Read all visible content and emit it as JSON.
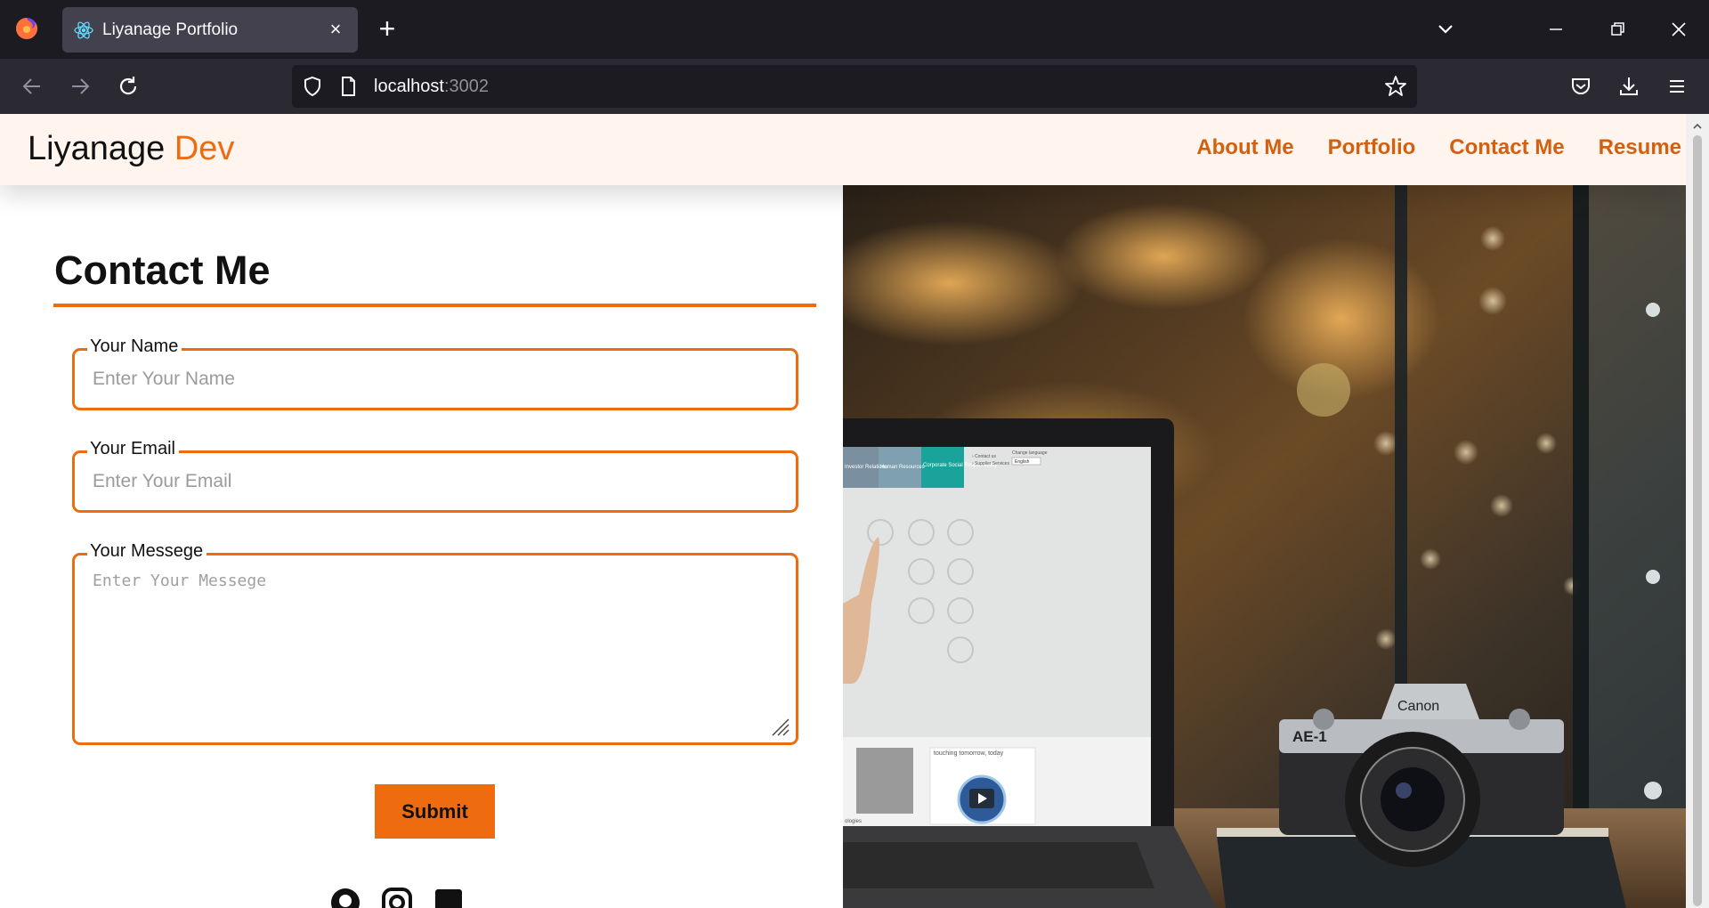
{
  "browser": {
    "tab_title": "Liyanage Portfolio",
    "url_host": "localhost",
    "url_port": ":3002"
  },
  "site": {
    "brand_main": "Liyanage",
    "brand_accent": "Dev",
    "nav": [
      "About Me",
      "Portfolio",
      "Contact Me",
      "Resume"
    ]
  },
  "contact": {
    "title": "Contact Me",
    "name_label": "Your Name",
    "name_placeholder": "Enter Your Name",
    "name_value": "",
    "email_label": "Your Email",
    "email_placeholder": "Enter Your Email",
    "email_value": "",
    "message_label": "Your Messege",
    "message_placeholder": "Enter Your Messege",
    "message_value": "",
    "submit_label": "Submit"
  },
  "colors": {
    "accent": "#ee6c0f",
    "header_bg": "#fff5ee",
    "chrome_dark": "#1c1b22"
  },
  "social_icons": [
    "github-icon",
    "instagram-icon",
    "linkedin-icon"
  ],
  "hero_image": {
    "laptop_screen_text": [
      "Investor Relations",
      "Human Resources",
      "Corporate Social Responsibility",
      "Contact us",
      "Supplier Services",
      "Change language",
      "English",
      "touching tomorrow, today",
      "ologies"
    ],
    "camera_text": [
      "Canon",
      "AE-1"
    ]
  }
}
